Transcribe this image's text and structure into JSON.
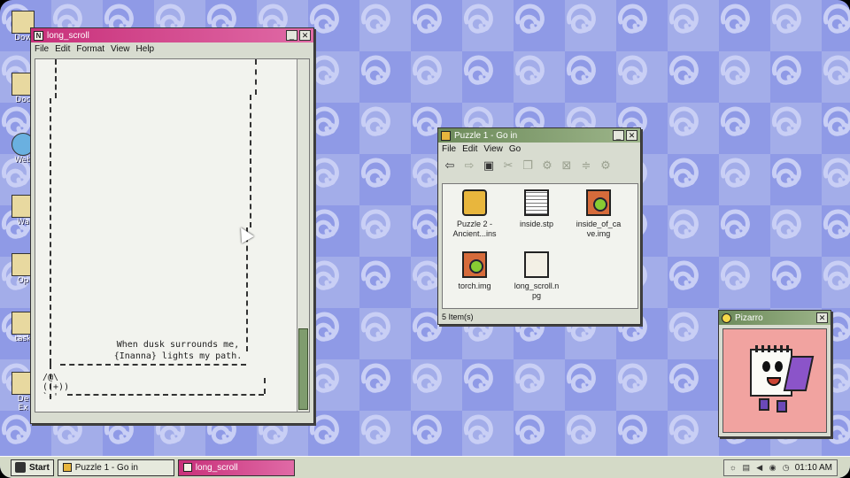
{
  "desktop": {
    "icons": [
      {
        "label": "Dow",
        "icon": "folder-icon"
      },
      {
        "label": "Doc",
        "icon": "folder-icon"
      },
      {
        "label": "Web",
        "icon": "globe-icon"
      },
      {
        "label": "Wa",
        "icon": "app-icon"
      },
      {
        "label": "Op",
        "icon": "app-icon"
      },
      {
        "label": "task",
        "icon": "app-icon"
      },
      {
        "label": "De",
        "icon": "app-icon"
      },
      {
        "label": "Ex",
        "icon": "app-icon"
      }
    ]
  },
  "notepad": {
    "title": "long_scroll",
    "icon_letter": "N",
    "menu": [
      "File",
      "Edit",
      "Format",
      "View",
      "Help"
    ],
    "poem_line1": "When dusk surrounds me,",
    "poem_line2": "{Inanna} lights my path.",
    "rod_line1": "/@\\",
    "rod_line2": "((+))",
    "rod_line3": "`-'"
  },
  "explorer": {
    "title": "Puzzle 1 - Go in",
    "menu": [
      "File",
      "Edit",
      "View",
      "Go"
    ],
    "toolbar": [
      {
        "icon": "back-arrow-icon",
        "glyph": "⇦",
        "enabled": true
      },
      {
        "icon": "forward-arrow-icon",
        "glyph": "⇨",
        "enabled": false
      },
      {
        "icon": "up-folder-icon",
        "glyph": "▣",
        "enabled": true
      },
      {
        "icon": "cut-icon",
        "glyph": "✂",
        "enabled": false
      },
      {
        "icon": "copy-icon",
        "glyph": "❐",
        "enabled": false
      },
      {
        "icon": "settings-icon",
        "glyph": "⚙",
        "enabled": false
      },
      {
        "icon": "delete-icon",
        "glyph": "⊠",
        "enabled": false
      },
      {
        "icon": "properties-icon",
        "glyph": "≑",
        "enabled": false
      },
      {
        "icon": "gear-icon",
        "glyph": "⚙",
        "enabled": false
      }
    ],
    "files": [
      {
        "name_line1": "Puzzle 2 -",
        "name_line2": "Ancient...ins",
        "type": "puzzle"
      },
      {
        "name_line1": "inside.stp",
        "name_line2": "",
        "type": "doc"
      },
      {
        "name_line1": "inside_of_ca",
        "name_line2": "ve.img",
        "type": "img"
      },
      {
        "name_line1": "torch.img",
        "name_line2": "",
        "type": "img"
      },
      {
        "name_line1": "long_scroll.n",
        "name_line2": "pg",
        "type": "note"
      }
    ],
    "status": "5 Item(s)"
  },
  "pizarro": {
    "title": "Pizarro"
  },
  "taskbar": {
    "start_label": "Start",
    "tasks": [
      {
        "label": "Puzzle 1 - Go in",
        "active": false
      },
      {
        "label": "long_scroll",
        "active": true
      }
    ],
    "clock": "01:10 AM"
  },
  "colors": {
    "notepad_title": "#c8307a",
    "explorer_title": "#6c8a5a",
    "wallpaper": "#8f9ae6"
  }
}
